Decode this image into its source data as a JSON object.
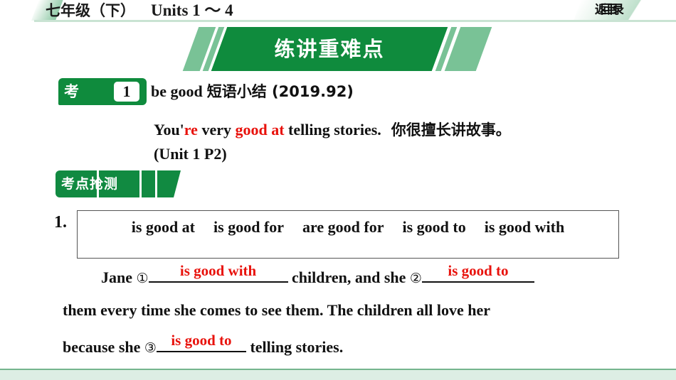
{
  "header": {
    "grade_label": "七年级（下）",
    "units_label": "Units 1 ～ 4",
    "back_button": "返回目录"
  },
  "banner": {
    "title": "练讲重难点"
  },
  "point": {
    "badge_label": "考点",
    "badge_number": "1",
    "title_en": "be good",
    "title_cn": "短语小结 (2019.92)"
  },
  "example": {
    "seg1": "You'",
    "seg2_red": "re",
    "seg3": " very ",
    "seg4_red": "good at",
    "seg5": " telling stories.",
    "translation": "你很擅长讲故事。",
    "source": "(Unit 1 P2)"
  },
  "quiz_tab": {
    "label": "考点抢测"
  },
  "question": {
    "number": "1.",
    "word_bank": [
      "is good at",
      "is good for",
      "are good for",
      "is good to",
      "is good with"
    ],
    "sentence": {
      "line1_pre": "Jane ",
      "mark1": "①",
      "answer1": "is good with",
      "line1_mid": " children, and she ",
      "mark2": "②",
      "answer2": "is good to",
      "line2": "them every time she comes to see them. The children all love her",
      "line3_pre": "because she ",
      "mark3": "③",
      "answer3": "is good to",
      "line3_post": " telling stories."
    }
  },
  "colors": {
    "brand_green": "#0f8b3d",
    "light_green": "#79c296",
    "answer_red": "#e8120c",
    "footer_green": "#ddeee4"
  }
}
